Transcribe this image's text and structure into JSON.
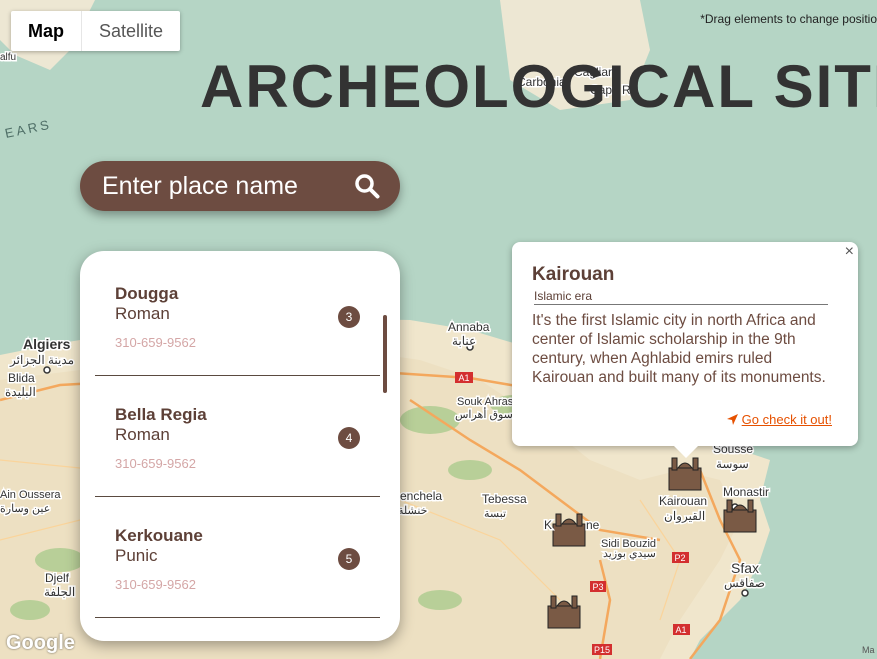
{
  "map_type": {
    "map_label": "Map",
    "satellite_label": "Satellite"
  },
  "drag_hint": "*Drag elements to change positio",
  "page_title": "ARCHEOLOGICAL SITE",
  "search": {
    "placeholder": "Enter place name",
    "icon": "search-icon"
  },
  "sites": [
    {
      "name": "Dougga",
      "era": "Roman",
      "phone": "310-659-9562",
      "badge": "3"
    },
    {
      "name": "Bella Regia",
      "era": "Roman",
      "phone": "310-659-9562",
      "badge": "4"
    },
    {
      "name": "Kerkouane",
      "era": "Punic",
      "phone": "310-659-9562",
      "badge": "5"
    }
  ],
  "info_window": {
    "close": "×",
    "title": "Kairouan",
    "subtitle": "Islamic era",
    "description": "It's the first Islamic city in north Africa and center of Islamic scholarship in the 9th century, when Aghlabid emirs ruled Kairouan and built many of its monuments.",
    "link": "Go check it out!",
    "link_icon": "navigation-arrow-icon"
  },
  "map_labels": {
    "algiers": "Algiers",
    "algiers_ar": "مدينة الجزائر",
    "blida": "Blida",
    "blida_ar": "البليدة",
    "annaba": "Annaba",
    "annaba_ar": "عنابة",
    "souk_ahras": "Souk Ahras",
    "souk_ahras_ar": "سوق أهراس",
    "tebessa": "Tebessa",
    "tebessa_ar": "تبسة",
    "khenchela": "enchela",
    "khenchela_ar": "خنشلة",
    "ain_oussera": "Ain Oussera",
    "ain_oussera_ar": "عين وسارة",
    "djelfa": "Djelf",
    "djelfa_ar": "الجلفة",
    "sidi_bouzid": "Sidi Bouzid",
    "sidi_bouzid_ar": "سيدي بوزيد",
    "kairouan": "Kairouan",
    "kairouan_ar": "القيروان",
    "sousse": "Sousse",
    "sousse_ar": "سوسة",
    "monastir": "Monastir",
    "sfax": "Sfax",
    "sfax_ar": "صفاقس",
    "kasserine": "K",
    "kasserine_tail": "ne",
    "cagliari": "Cagliar",
    "carbonia": "Carbonia",
    "capo": "Capo Re",
    "sea": "EARS",
    "alfu": "alfu"
  },
  "road_labels": [
    "A1",
    "A1",
    "P2",
    "P3",
    "A1",
    "P15"
  ],
  "google_logo": "Google",
  "map_attrib": "Ma",
  "colors": {
    "brown": "#6d4c41",
    "water": "#b5d5c5",
    "land": "#f2e9d1",
    "link": "#e65100"
  }
}
